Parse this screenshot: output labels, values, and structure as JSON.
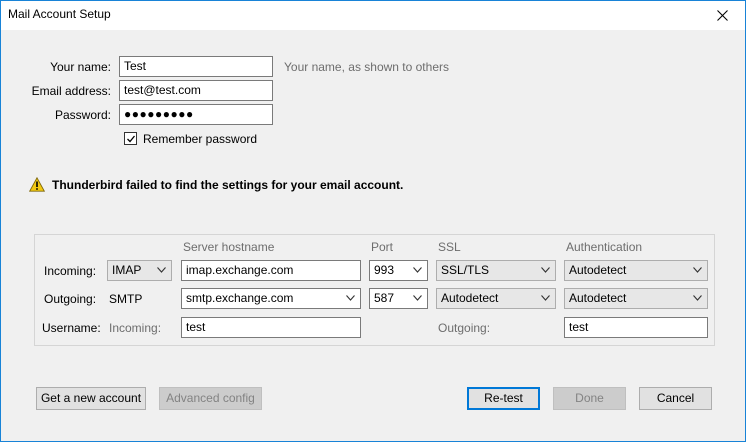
{
  "window": {
    "title": "Mail Account Setup"
  },
  "identity": {
    "name_label": "Your name:",
    "name_value": "Test",
    "name_hint": "Your name, as shown to others",
    "email_label": "Email address:",
    "email_value": "test@test.com",
    "password_label": "Password:",
    "password_value": "●●●●●●●●●",
    "remember_label": "Remember password",
    "remember_checked": true
  },
  "warning": {
    "icon": "warning-triangle-icon",
    "message": "Thunderbird failed to find the settings for your email account."
  },
  "server_table": {
    "headers": {
      "hostname": "Server hostname",
      "port": "Port",
      "ssl": "SSL",
      "authentication": "Authentication"
    },
    "incoming": {
      "label": "Incoming:",
      "protocol": "IMAP",
      "hostname": "imap.exchange.com",
      "port": "993",
      "ssl": "SSL/TLS",
      "auth": "Autodetect"
    },
    "outgoing": {
      "label": "Outgoing:",
      "protocol": "SMTP",
      "hostname": "smtp.exchange.com",
      "port": "587",
      "ssl": "Autodetect",
      "auth": "Autodetect"
    },
    "username": {
      "label": "Username:",
      "incoming_label": "Incoming:",
      "incoming_value": "test",
      "outgoing_label": "Outgoing:",
      "outgoing_value": "test"
    }
  },
  "buttons": {
    "new_account": "Get a new account",
    "advanced": "Advanced config",
    "retest": "Re-test",
    "done": "Done",
    "cancel": "Cancel"
  },
  "colors": {
    "accent": "#0078d7",
    "warning": "#f2c811"
  }
}
